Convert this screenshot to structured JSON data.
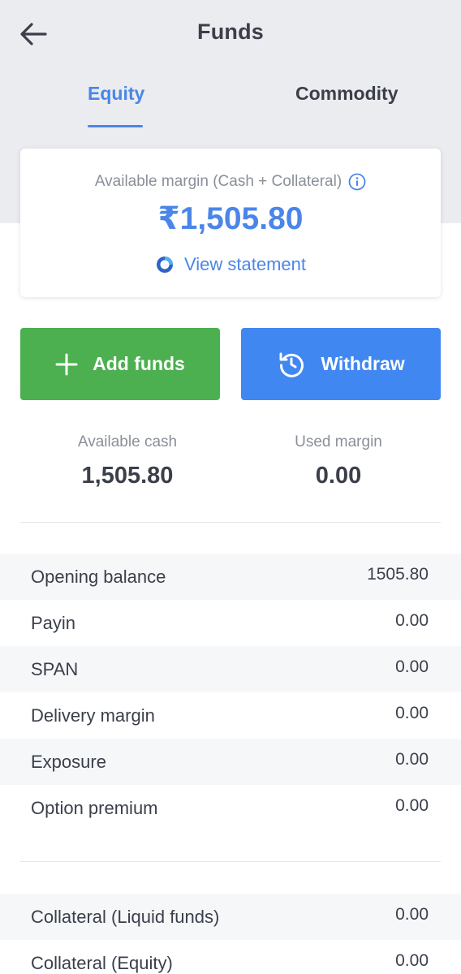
{
  "header": {
    "title": "Funds",
    "back_icon": "arrow-left-icon"
  },
  "tabs": [
    {
      "label": "Equity",
      "active": true
    },
    {
      "label": "Commodity",
      "active": false
    }
  ],
  "margin_card": {
    "label": "Available margin (Cash + Collateral)",
    "value": "₹1,505.80",
    "view_statement": "View statement"
  },
  "actions": {
    "add_funds": "Add funds",
    "withdraw": "Withdraw"
  },
  "summary": {
    "available_cash_label": "Available cash",
    "available_cash_value": "1,505.80",
    "used_margin_label": "Used margin",
    "used_margin_value": "0.00"
  },
  "rows": [
    {
      "label": "Opening balance",
      "value": "1505.80"
    },
    {
      "label": "Payin",
      "value": "0.00"
    },
    {
      "label": "SPAN",
      "value": "0.00"
    },
    {
      "label": "Delivery margin",
      "value": "0.00"
    },
    {
      "label": "Exposure",
      "value": "0.00"
    },
    {
      "label": "Option premium",
      "value": "0.00"
    }
  ],
  "collateral_rows": [
    {
      "label": "Collateral (Liquid funds)",
      "value": "0.00"
    },
    {
      "label": "Collateral (Equity)",
      "value": "0.00"
    }
  ],
  "colors": {
    "accent_blue": "#4a86e8",
    "add_green": "#4caf50",
    "withdraw_blue": "#4187f2",
    "header_bg": "#ebecef"
  }
}
